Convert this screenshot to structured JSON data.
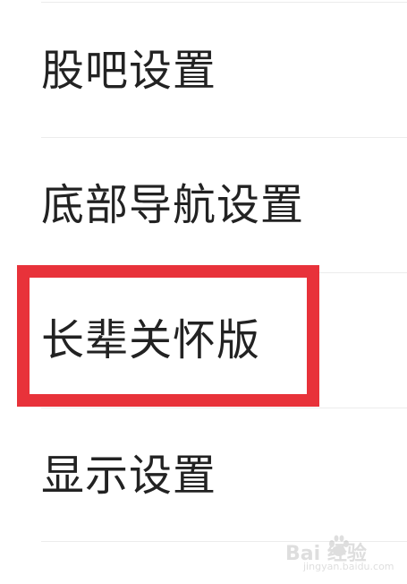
{
  "settings": {
    "items": [
      {
        "label": "股吧设置"
      },
      {
        "label": "底部导航设置"
      },
      {
        "label": "长辈关怀版"
      },
      {
        "label": "显示设置"
      }
    ]
  },
  "annotation": {
    "highlight_color": "#e8323a",
    "highlighted_item": "长辈关怀版"
  },
  "watermark": {
    "brand": "Bai 经验",
    "url": "jingyan.baidu.com"
  }
}
